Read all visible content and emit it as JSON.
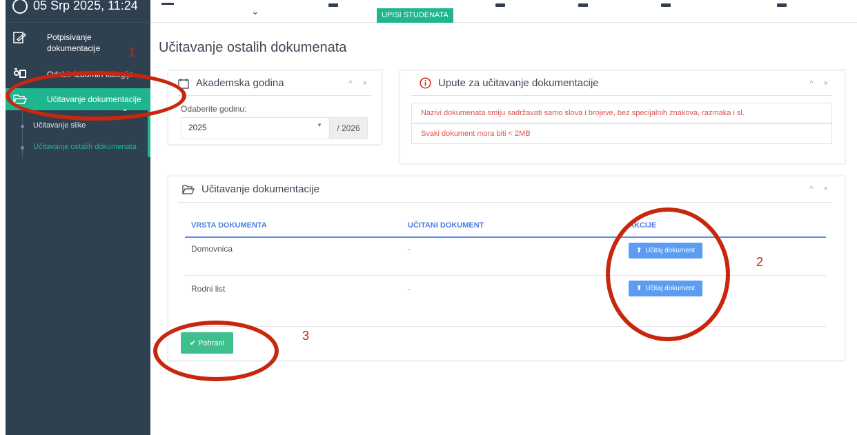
{
  "header": {
    "datetime": "05 Srp 2025, 11:24",
    "active_tab": "UPISI STUDENATA"
  },
  "sidebar": {
    "items": [
      {
        "label": "Potpisivanje dokumentacije"
      },
      {
        "label": "Odabir izbornih kolegija"
      },
      {
        "label": "Učitavanje dokumentacije"
      }
    ],
    "subitems": [
      {
        "label": "Učitavanje slike"
      },
      {
        "label": "Učitavanje ostalih dokumenata"
      }
    ]
  },
  "page": {
    "title": "Učitavanje ostalih dokumenata"
  },
  "academic_year": {
    "title": "Akademska godina",
    "select_label": "Odaberite godinu:",
    "selected_year": "2025",
    "end_year": "/ 2026"
  },
  "instructions": {
    "title": "Upute za učitavanje dokumentacije",
    "lines": [
      "Nazivi dokumenata smiju sadržavati samo slova i brojeve, bez specijalnih znakova, razmaka i sl.",
      "Svaki dokument mora biti < 2MB"
    ]
  },
  "upload": {
    "title": "Učitavanje dokumentacije",
    "columns": [
      "VRSTA DOKUMENTA",
      "UČITANI DOKUMENT",
      "AKCIJE"
    ],
    "rows": [
      {
        "type": "Domovnica",
        "loaded": "-",
        "action": "Učitaj dokument"
      },
      {
        "type": "Rodni list",
        "loaded": "-",
        "action": "Učitaj dokument"
      }
    ],
    "save_label": "Pohrani"
  },
  "annotations": [
    "1",
    "2",
    "3"
  ],
  "colors": {
    "sidebar": "#2f4050",
    "accent": "#1fb58f",
    "link": "#4a7ee0",
    "warning": "#d9534f",
    "annotation": "#c8260e"
  }
}
